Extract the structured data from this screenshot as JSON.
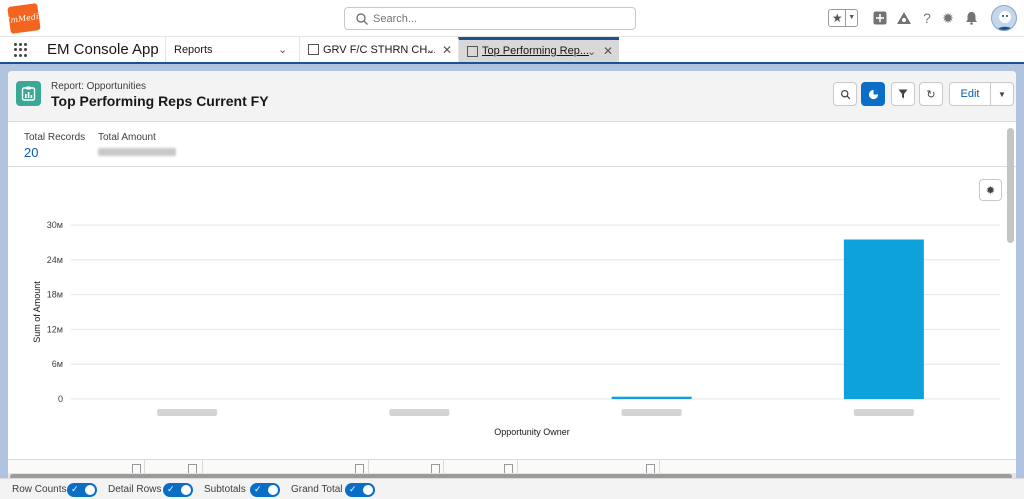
{
  "header": {
    "logo_text": "EmMedia",
    "search": {
      "placeholder": "Search..."
    },
    "icons": [
      "favorites-star-icon",
      "favorites-list-icon",
      "add-icon",
      "trailhead-icon",
      "help-icon",
      "setup-gear-icon",
      "notifications-bell-icon",
      "avatar"
    ]
  },
  "nav": {
    "app_name": "EM Console App",
    "tabs": [
      {
        "label": "Reports",
        "active": false
      },
      {
        "label": "GRV F/C STHRN CH...",
        "active": false
      },
      {
        "label": "Top Performing Rep...",
        "active": true
      }
    ]
  },
  "report": {
    "subtitle": "Report: Opportunities",
    "title": "Top Performing Reps Current FY",
    "edit_label": "Edit",
    "stats": {
      "total_records_label": "Total Records",
      "total_records_value": "20",
      "total_amount_label": "Total Amount"
    }
  },
  "chart_data": {
    "type": "bar",
    "categories": [
      "",
      "",
      "",
      ""
    ],
    "values": [
      0,
      0,
      0.4,
      27.5
    ],
    "units": "M",
    "ylabel": "Sum of Amount",
    "xlabel": "Opportunity Owner",
    "ylim": [
      0,
      30
    ],
    "yticks": [
      0,
      6,
      12,
      18,
      24,
      30
    ],
    "ytick_labels": [
      "0",
      "6м",
      "12м",
      "18м",
      "24м",
      "30м"
    ],
    "grid": true,
    "bar_color": "#0ea2dd"
  },
  "footer": {
    "toggles": [
      {
        "label": "Row Counts",
        "on": true
      },
      {
        "label": "Detail Rows",
        "on": true
      },
      {
        "label": "Subtotals",
        "on": true
      },
      {
        "label": "Grand Total",
        "on": true
      }
    ]
  },
  "colors": {
    "brand": "#1b5297",
    "accent": "#0b6ec6",
    "report_icon": "#3ba895",
    "logo": "#f3641e"
  }
}
